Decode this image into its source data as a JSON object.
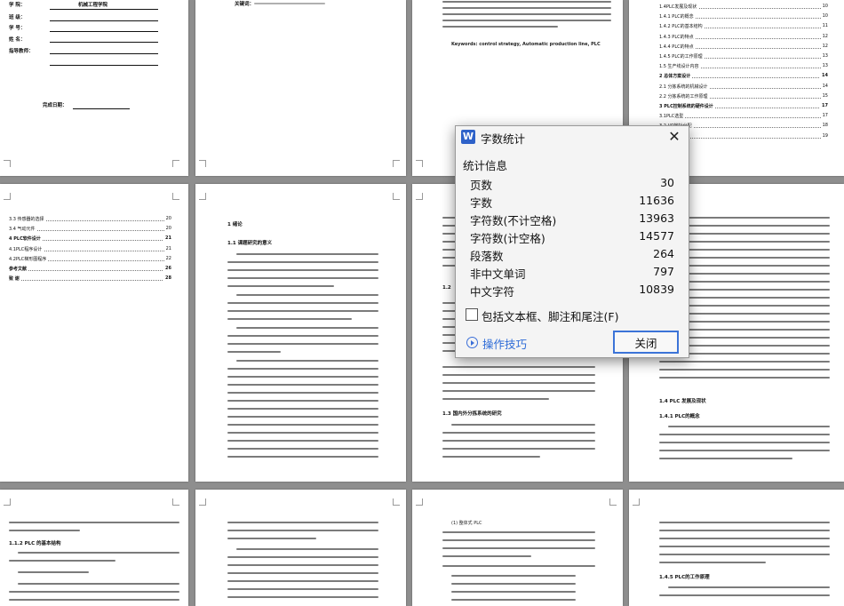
{
  "dialog": {
    "title": "字数统计",
    "app_icon_letter": "W",
    "section_title": "统计信息",
    "stats": [
      {
        "label": "页数",
        "value": "30"
      },
      {
        "label": "字数",
        "value": "11636"
      },
      {
        "label": "字符数(不计空格)",
        "value": "13963"
      },
      {
        "label": "字符数(计空格)",
        "value": "14577"
      },
      {
        "label": "段落数",
        "value": "264"
      },
      {
        "label": "非中文单词",
        "value": "797"
      },
      {
        "label": "中文字符",
        "value": "10839"
      }
    ],
    "include_checkbox_label": "包括文本框、脚注和尾注(F)",
    "include_checked": false,
    "help_link": "操作技巧",
    "close_button": "关闭",
    "accent_color": "#2e62c9"
  },
  "pages": {
    "cover": {
      "rows": [
        {
          "label": "学  院：",
          "value": "机械工程学院"
        },
        {
          "label": "班  级：",
          "value": ""
        },
        {
          "label": "学  号：",
          "value": ""
        },
        {
          "label": "姓  名：",
          "value": ""
        },
        {
          "label": "指导教师：",
          "value": ""
        }
      ],
      "date_label": "完成日期："
    },
    "abstract_keywords": "关键词：",
    "keywords_en": "Keywords: control strategy, Automatic production line, PLC",
    "toc_top": [
      {
        "text": "1.4PLC发展及现状",
        "page": "10",
        "bold": false
      },
      {
        "text": "1.4.1 PLC的概念",
        "page": "10",
        "bold": false
      },
      {
        "text": "1.4.2 PLC的基本结构",
        "page": "11",
        "bold": false
      },
      {
        "text": "1.4.3 PLC的特点",
        "page": "12",
        "bold": false
      },
      {
        "text": "1.4.4 PLC的特点",
        "page": "12",
        "bold": false
      },
      {
        "text": "1.4.5 PLC的工作原理",
        "page": "13",
        "bold": false
      },
      {
        "text": "1.5 生产线设计内容",
        "page": "13",
        "bold": false
      },
      {
        "text": "2 总体方案设计",
        "page": "14",
        "bold": true
      },
      {
        "text": "2.1 分拣系统的机械设计",
        "page": "14",
        "bold": false
      },
      {
        "text": "2.2 分拣系统的工作原理",
        "page": "15",
        "bold": false
      },
      {
        "text": "3 PLC控制系统的硬件设计",
        "page": "17",
        "bold": true
      },
      {
        "text": "3.1PLC选型",
        "page": "17",
        "bold": false
      },
      {
        "text": "3.2 I/O地址分配",
        "page": "18",
        "bold": false
      },
      {
        "text": "3.3 接线图",
        "page": "19",
        "bold": false
      }
    ],
    "toc_mid": [
      {
        "text": "3.3 传感器的选择",
        "page": "20",
        "bold": false
      },
      {
        "text": "3.4 气动元件",
        "page": "20",
        "bold": false
      },
      {
        "text": "4 PLC软件设计",
        "page": "21",
        "bold": true
      },
      {
        "text": "4.1PLC程序设计",
        "page": "21",
        "bold": false
      },
      {
        "text": "4.2PLC梯形图程序",
        "page": "22",
        "bold": false
      },
      {
        "text": "参考文献",
        "page": "26",
        "bold": true
      },
      {
        "text": "致  谢",
        "page": "28",
        "bold": true
      }
    ],
    "intro": {
      "chapter": "1 绪论",
      "section": "1.1 课题研究的意义"
    },
    "page3_sections": {
      "s12": "1.2",
      "s13": "1.3 国内外分拣系统的研究"
    },
    "page4_sections": {
      "s14": "1.4 PLC 发展及现状",
      "s141": "1.4.1 PLC的概念"
    },
    "row3": {
      "p1_section": "1.1.2 PLC 的基本结构",
      "p3_title": "(1) 整体式 PLC",
      "p4_section": "1.4.5 PLC的工作原理"
    }
  }
}
